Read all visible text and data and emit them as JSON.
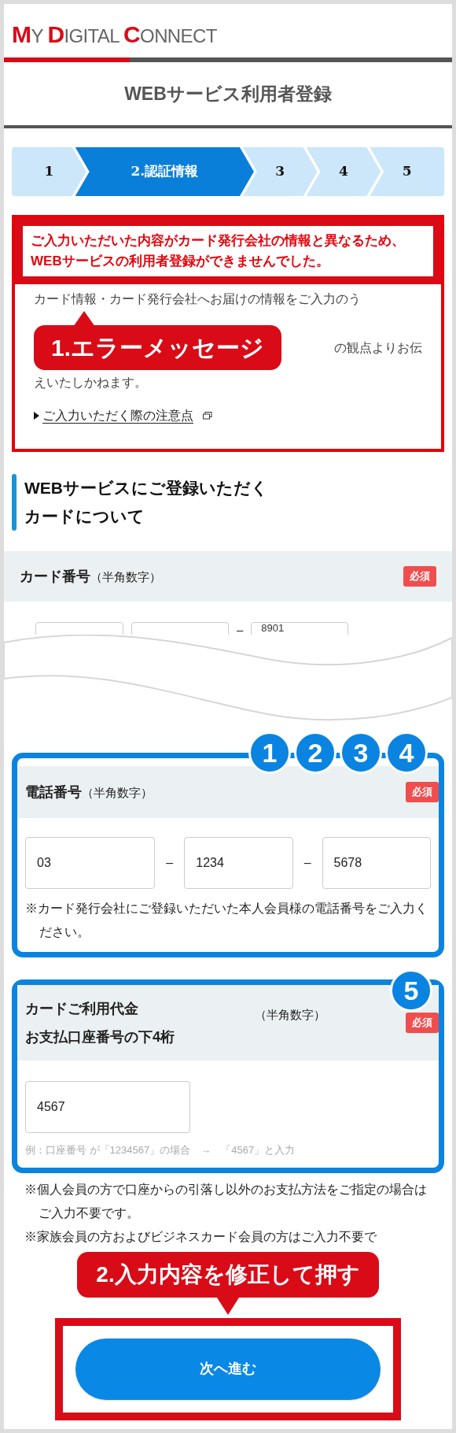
{
  "header": {
    "logo": [
      {
        "text": "M",
        "accent": true
      },
      {
        "text": "Y ",
        "accent": false
      },
      {
        "text": "D",
        "accent": true
      },
      {
        "text": "IGITAL ",
        "accent": false
      },
      {
        "text": "C",
        "accent": true
      },
      {
        "text": "ONNECT",
        "accent": false
      }
    ]
  },
  "page_title": "WEBサービス利用者登録",
  "steps": [
    {
      "label": "1",
      "selected": false
    },
    {
      "label": "2.認証情報",
      "selected": true
    },
    {
      "label": "3",
      "selected": false
    },
    {
      "label": "4",
      "selected": false
    },
    {
      "label": "5",
      "selected": false
    }
  ],
  "error_panel": {
    "message": "ご入力いただいた内容がカード発行会社の情報と異なるため、WEBサービスの利用者登録ができませんでした。",
    "body_line_1": "カード情報・カード発行会社へお届けの情報をご入力のう",
    "body_line_2": "の観点よりお伝",
    "body_line_3": "えいたしかねます。",
    "link": "ご入力いただく際の注意点"
  },
  "annotations": {
    "error_callout": "1.エラーメッセージ",
    "button_callout": "2.入力内容を修正して押す"
  },
  "section_heading": [
    "WEBサービスにご登録いただく",
    "カードについて"
  ],
  "card_number": {
    "label": "カード番号",
    "hint": "（半角数字）",
    "badge": "必須",
    "separator": "–",
    "last_value": "8901"
  },
  "phone": {
    "label": "電話番号",
    "hint": "（半角数字）",
    "badge": "必須",
    "markers": [
      "1",
      "2",
      "3",
      "4"
    ],
    "fields": [
      "03",
      "1234",
      "5678"
    ],
    "separators": [
      "–",
      "–"
    ],
    "note": "※カード発行会社にご登録いただいた本人会員様の電話番号をご入力ください。"
  },
  "account": {
    "label_lines": [
      "カードご利用代金",
      "お支払口座番号の下4桁"
    ],
    "hint": "（半角数字）",
    "badge": "必須",
    "marker": "5",
    "value": "4567",
    "example": "例：口座番号 が「1234567」の場合　→　「4567」と入力"
  },
  "notes": [
    "※個人会員の方で口座からの引落し以外のお支払方法をご指定の場合はご入力不要です。",
    "※家族会員の方およびビジネスカード会員の方はご入力不要で"
  ],
  "submit": "次へ進む"
}
